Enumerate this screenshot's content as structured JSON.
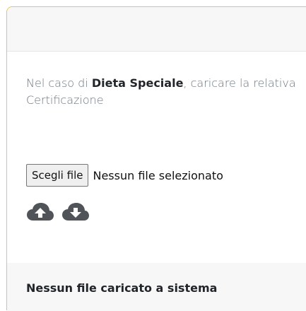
{
  "colors": {
    "panel_border": "#f2c24a",
    "header_bg": "#f7f7f7",
    "icon_fill": "#505459"
  },
  "intro": {
    "prefix": "Nel caso di",
    "highlight": "Dieta Speciale",
    "suffix": ", caricare la relativa Certificazione"
  },
  "upload": {
    "choose_button": "Scegli file",
    "status": "Nessun file selezionato"
  },
  "icons": {
    "upload": "cloud-upload-icon",
    "download": "cloud-download-icon"
  },
  "footer": {
    "message": "Nessun file caricato a sistema"
  }
}
